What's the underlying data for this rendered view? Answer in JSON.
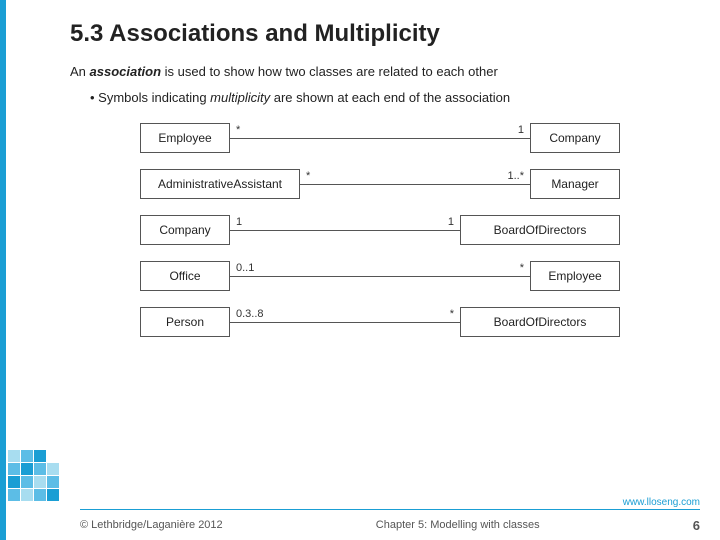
{
  "title": "5.3 Associations and Multiplicity",
  "intro": {
    "line1": "An association is used to show how two classes are related to each other",
    "bullet": "Symbols indicating multiplicity are shown at each end of the association"
  },
  "uml_rows": [
    {
      "left_box": "Employee",
      "left_mult": "*",
      "right_mult": "1",
      "right_box": "Company"
    },
    {
      "left_box": "AdministrativeAssistant",
      "left_mult": "*",
      "right_mult": "1..*",
      "right_box": "Manager"
    },
    {
      "left_box": "Company",
      "left_mult": "1",
      "right_mult": "1",
      "right_box": "BoardOfDirectors"
    },
    {
      "left_box": "Office",
      "left_mult": "0..1",
      "right_mult": "*",
      "right_box": "Employee"
    },
    {
      "left_box": "Person",
      "left_mult": "0.3..8",
      "right_mult": "*",
      "right_box": "BoardOfDirectors"
    }
  ],
  "footer": {
    "copyright": "© Lethbridge/Laganière 2012",
    "chapter": "Chapter 5: Modelling with classes",
    "page": "6",
    "url": "www.lloseng.com"
  }
}
